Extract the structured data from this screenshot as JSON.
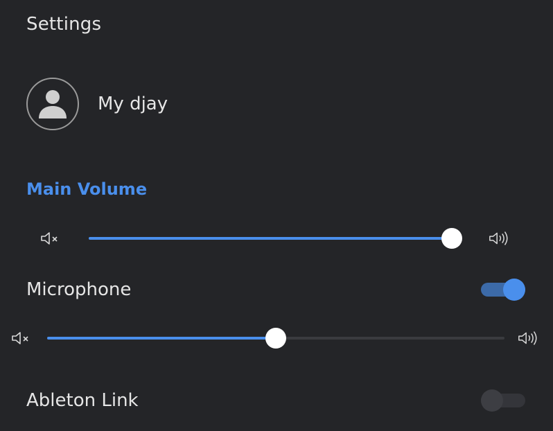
{
  "header": {
    "title": "Settings"
  },
  "profile": {
    "label": "My djay",
    "icon": "user-icon"
  },
  "main_volume": {
    "section_title": "Main Volume",
    "level": 1.0,
    "min_icon": "volume-mute-icon",
    "max_icon": "volume-high-icon"
  },
  "microphone": {
    "label": "Microphone",
    "enabled": true,
    "level": 0.5,
    "min_icon": "volume-mute-icon",
    "max_icon": "volume-high-icon"
  },
  "ableton_link": {
    "label": "Ableton Link",
    "enabled": false
  },
  "colors": {
    "background": "#242528",
    "accent": "#4a8fec",
    "toggle_on_track": "#3c6aa8",
    "toggle_off_track": "#34353a",
    "toggle_off_knob": "#3d3e43",
    "text": "#e6e6e6"
  }
}
